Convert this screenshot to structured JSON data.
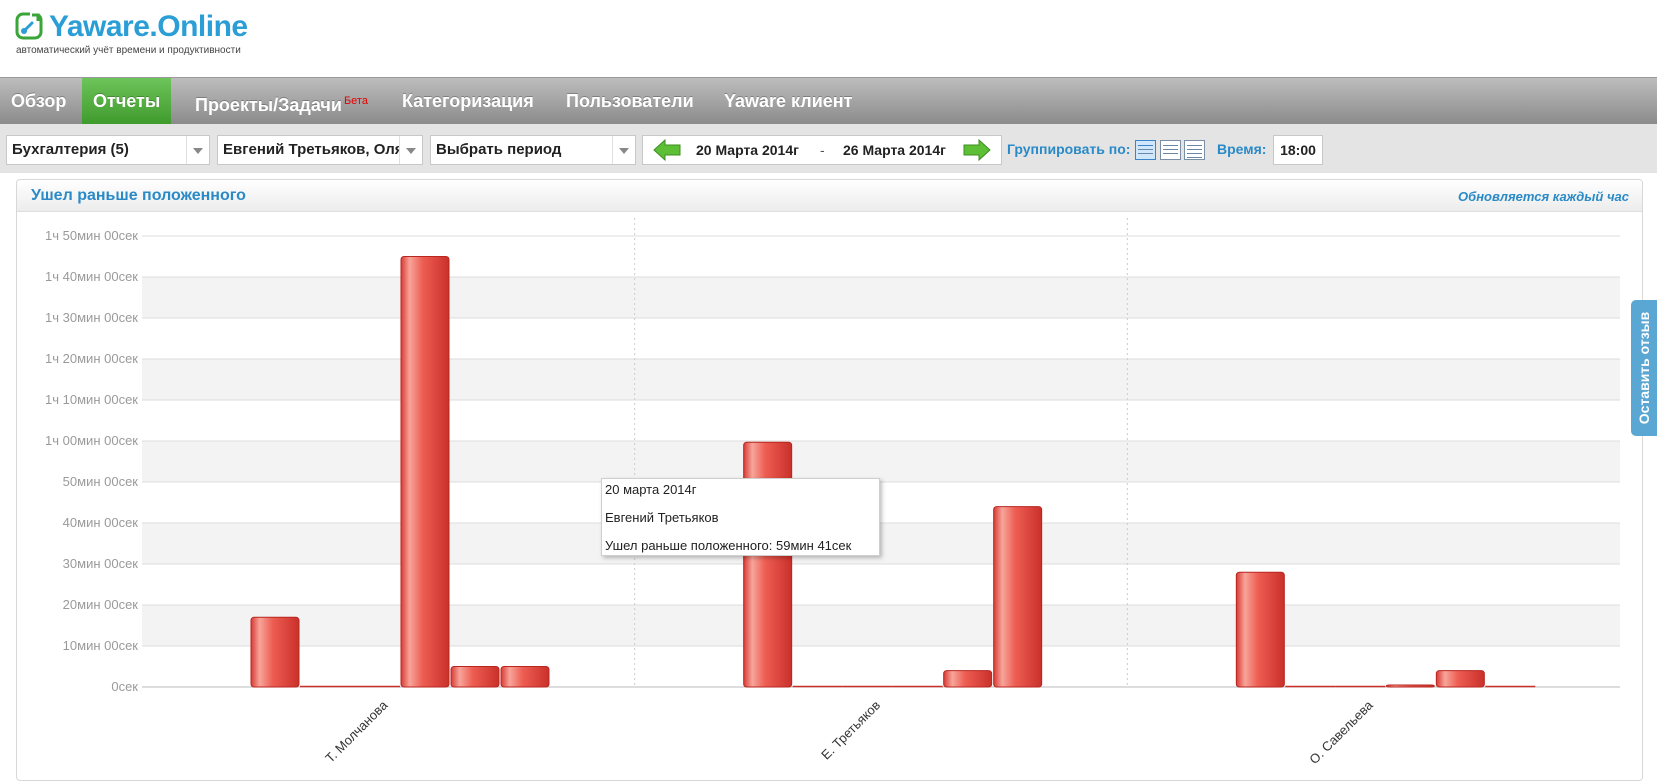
{
  "app": {
    "logo_text": "Yaware.Online",
    "logo_subtitle": "автоматический учёт времени и продуктивности"
  },
  "nav": {
    "items": [
      {
        "label": "Обзор",
        "active": false
      },
      {
        "label": "Отчеты",
        "active": true
      },
      {
        "label": "Проекты/Задачи",
        "active": false,
        "badge": "Бета"
      },
      {
        "label": "Категоризация",
        "active": false
      },
      {
        "label": "Пользователи",
        "active": false
      },
      {
        "label": "Yaware клиент",
        "active": false
      }
    ]
  },
  "filters": {
    "department": "Бухгалтерия (5)",
    "users": "Евгений Третьяков, Оля",
    "period": "Выбрать период",
    "date_from": "20 Марта 2014г",
    "date_separator": "-",
    "date_to": "26 Марта 2014г",
    "group_by_label": "Группировать по:",
    "time_label": "Время:",
    "time_value": "18:00"
  },
  "panel": {
    "title": "Ушел раньше положенного",
    "note": "Обновляется каждый час"
  },
  "colors": {
    "accent": "#2a8ac7",
    "nav_active": "#4fae3a",
    "bar_fill": "#e8514a",
    "feedback": "#5aa7d3"
  },
  "tooltip": {
    "date": "20 марта 2014г",
    "user": "Евгений Третьяков",
    "value_line": "Ушел раньше положенного: 59мин 41сек"
  },
  "feedback_label": "Оставить отзыв",
  "chart_data": {
    "type": "bar",
    "unit": "minutes",
    "ylim": [
      0,
      110
    ],
    "y_ticks": [
      {
        "value": 0,
        "label": "0сек"
      },
      {
        "value": 10,
        "label": "10мин 00сек"
      },
      {
        "value": 20,
        "label": "20мин 00сек"
      },
      {
        "value": 30,
        "label": "30мин 00сек"
      },
      {
        "value": 40,
        "label": "40мин 00сек"
      },
      {
        "value": 50,
        "label": "50мин 00сек"
      },
      {
        "value": 60,
        "label": "1ч 00мин 00сек"
      },
      {
        "value": 70,
        "label": "1ч 10мин 00сек"
      },
      {
        "value": 80,
        "label": "1ч 20мин 00сек"
      },
      {
        "value": 90,
        "label": "1ч 30мин 00сек"
      },
      {
        "value": 100,
        "label": "1ч 40мин 00сек"
      },
      {
        "value": 110,
        "label": "1ч 50мин 00сек"
      }
    ],
    "grid": true,
    "categories": [
      "Т. Молчанова",
      "Е. Третьяков",
      "О. Савельева"
    ],
    "values": [
      [
        17,
        0,
        0,
        105,
        5,
        5
      ],
      [
        59.7,
        0,
        0,
        0,
        4,
        44
      ],
      [
        28,
        0,
        0,
        0.5,
        4,
        0
      ]
    ]
  }
}
